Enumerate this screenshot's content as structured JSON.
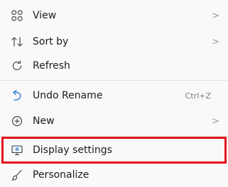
{
  "menu": {
    "items": [
      {
        "label": "View",
        "icon": "grid-icon",
        "has_submenu": true,
        "submenu_glyph": ">"
      },
      {
        "label": "Sort by",
        "icon": "sort-icon",
        "has_submenu": true,
        "submenu_glyph": ">"
      },
      {
        "label": "Refresh",
        "icon": "refresh-icon"
      },
      {
        "label": "Undo Rename",
        "icon": "undo-icon",
        "shortcut": "Ctrl+Z"
      },
      {
        "label": "New",
        "icon": "plus-circle-icon",
        "has_submenu": true,
        "submenu_glyph": ">"
      },
      {
        "label": "Display settings",
        "icon": "display-settings-icon",
        "highlighted": true
      },
      {
        "label": "Personalize",
        "icon": "brush-icon"
      }
    ]
  },
  "colors": {
    "menu_background": "#f9f9f9",
    "highlight_border": "#e3141e",
    "icon_gray": "#4a4a4a",
    "undo_accent": "#3a86d6"
  }
}
